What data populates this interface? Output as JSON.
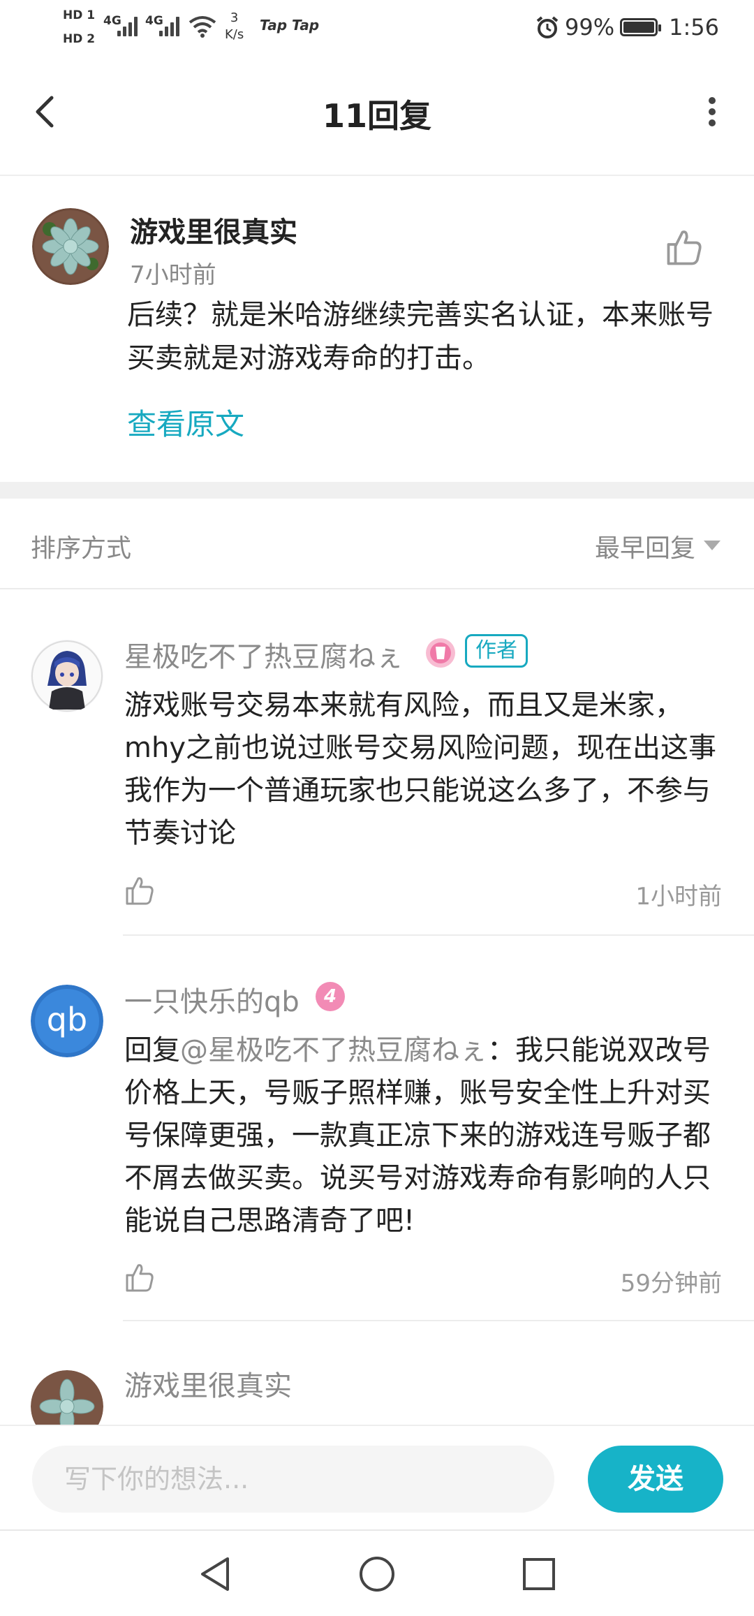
{
  "status_bar": {
    "hd1": "HD 1",
    "hd2": "HD 2",
    "net1": "4G",
    "net2": "4G",
    "speed_value": "3",
    "speed_unit": "K/s",
    "app1": "Tap Tap",
    "battery": "99%",
    "time": "1:56"
  },
  "header": {
    "title": "11回复"
  },
  "post": {
    "author": "游戏里很真实",
    "time": "7小时前",
    "body": "后续？就是米哈游继续完善实名认证，本来账号买卖就是对游戏寿命的打击。",
    "view_original": "查看原文"
  },
  "sort": {
    "label": "排序方式",
    "value": "最早回复"
  },
  "replies": [
    {
      "name": "星极吃不了热豆腐ねぇ",
      "badge": "作者",
      "body": "游戏账号交易本来就有风险，而且又是米家，mhy之前也说过账号交易风险问题，现在出这事我作为一个普通玩家也只能说这么多了，不参与节奏讨论",
      "time": "1小时前"
    },
    {
      "name": "一只快乐的qb",
      "level": "4",
      "avatar_text": "qb",
      "reply_prefix": "回复",
      "mention": "@星极吃不了热豆腐ねぇ",
      "colon": "：",
      "body": "我只能说双改号价格上天，号贩子照样赚，账号安全性上升对买号保障更强，一款真正凉下来的游戏连号贩子都不屑去做买卖。说买号对游戏寿命有影响的人只能说自己思路清奇了吧!",
      "time": "59分钟前"
    },
    {
      "name": "游戏里很真实"
    }
  ],
  "input": {
    "placeholder": "写下你的想法...",
    "send": "发送"
  },
  "colors": {
    "accent": "#17b3c8",
    "link": "#17a9c0",
    "muted": "#8a8a8a"
  }
}
